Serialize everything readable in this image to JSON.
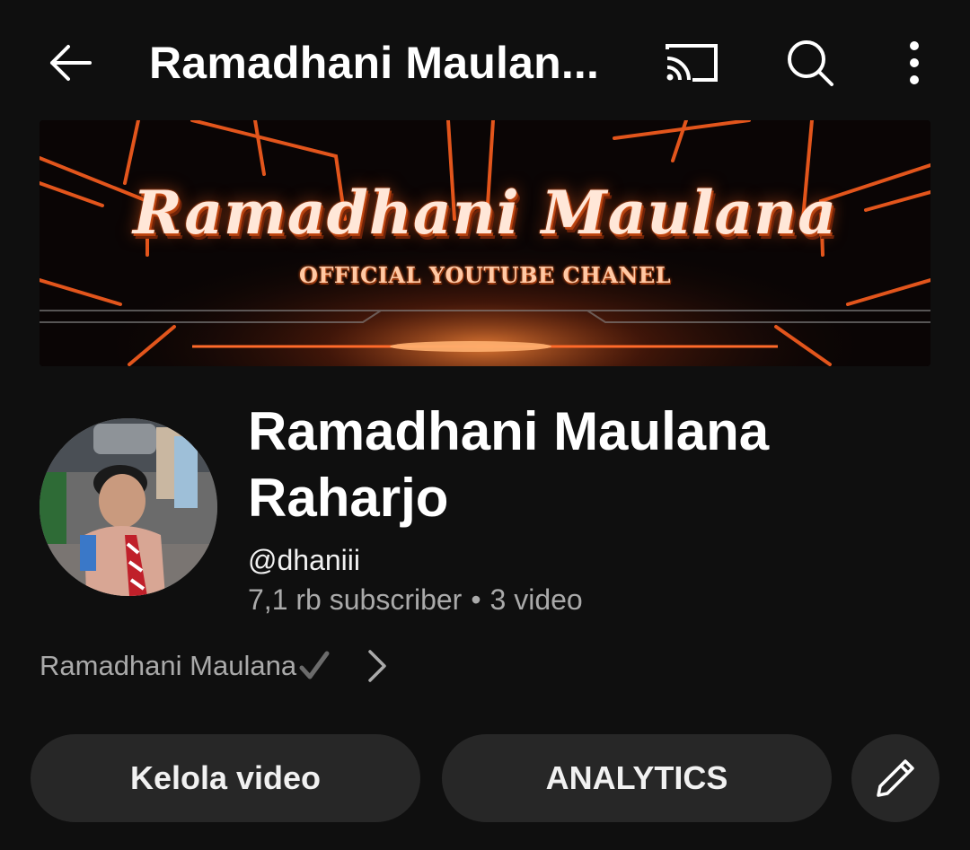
{
  "topbar": {
    "title": "Ramadhani Maulan...",
    "icons": [
      "back-arrow-icon",
      "cast-icon",
      "search-icon",
      "more-vertical-icon"
    ]
  },
  "banner": {
    "title": "Ramadhani Maulana",
    "subtitle": "OFFICIAL YOUTUBE CHANEL",
    "accent_color": "#ff5a1a"
  },
  "channel": {
    "name": "Ramadhani Maulana Raharjo",
    "handle": "@dhaniii",
    "subscribers": "7,1 rb subscriber",
    "separator": "•",
    "videos": "3 video",
    "description": "Ramadhani Maulana"
  },
  "actions": {
    "manage_label": "Kelola video",
    "analytics_label": "ANALYTICS",
    "edit_icon": "pencil-icon"
  },
  "colors": {
    "background": "#0f0f0f",
    "pill": "#272727",
    "secondary_text": "#aaaaaa"
  }
}
